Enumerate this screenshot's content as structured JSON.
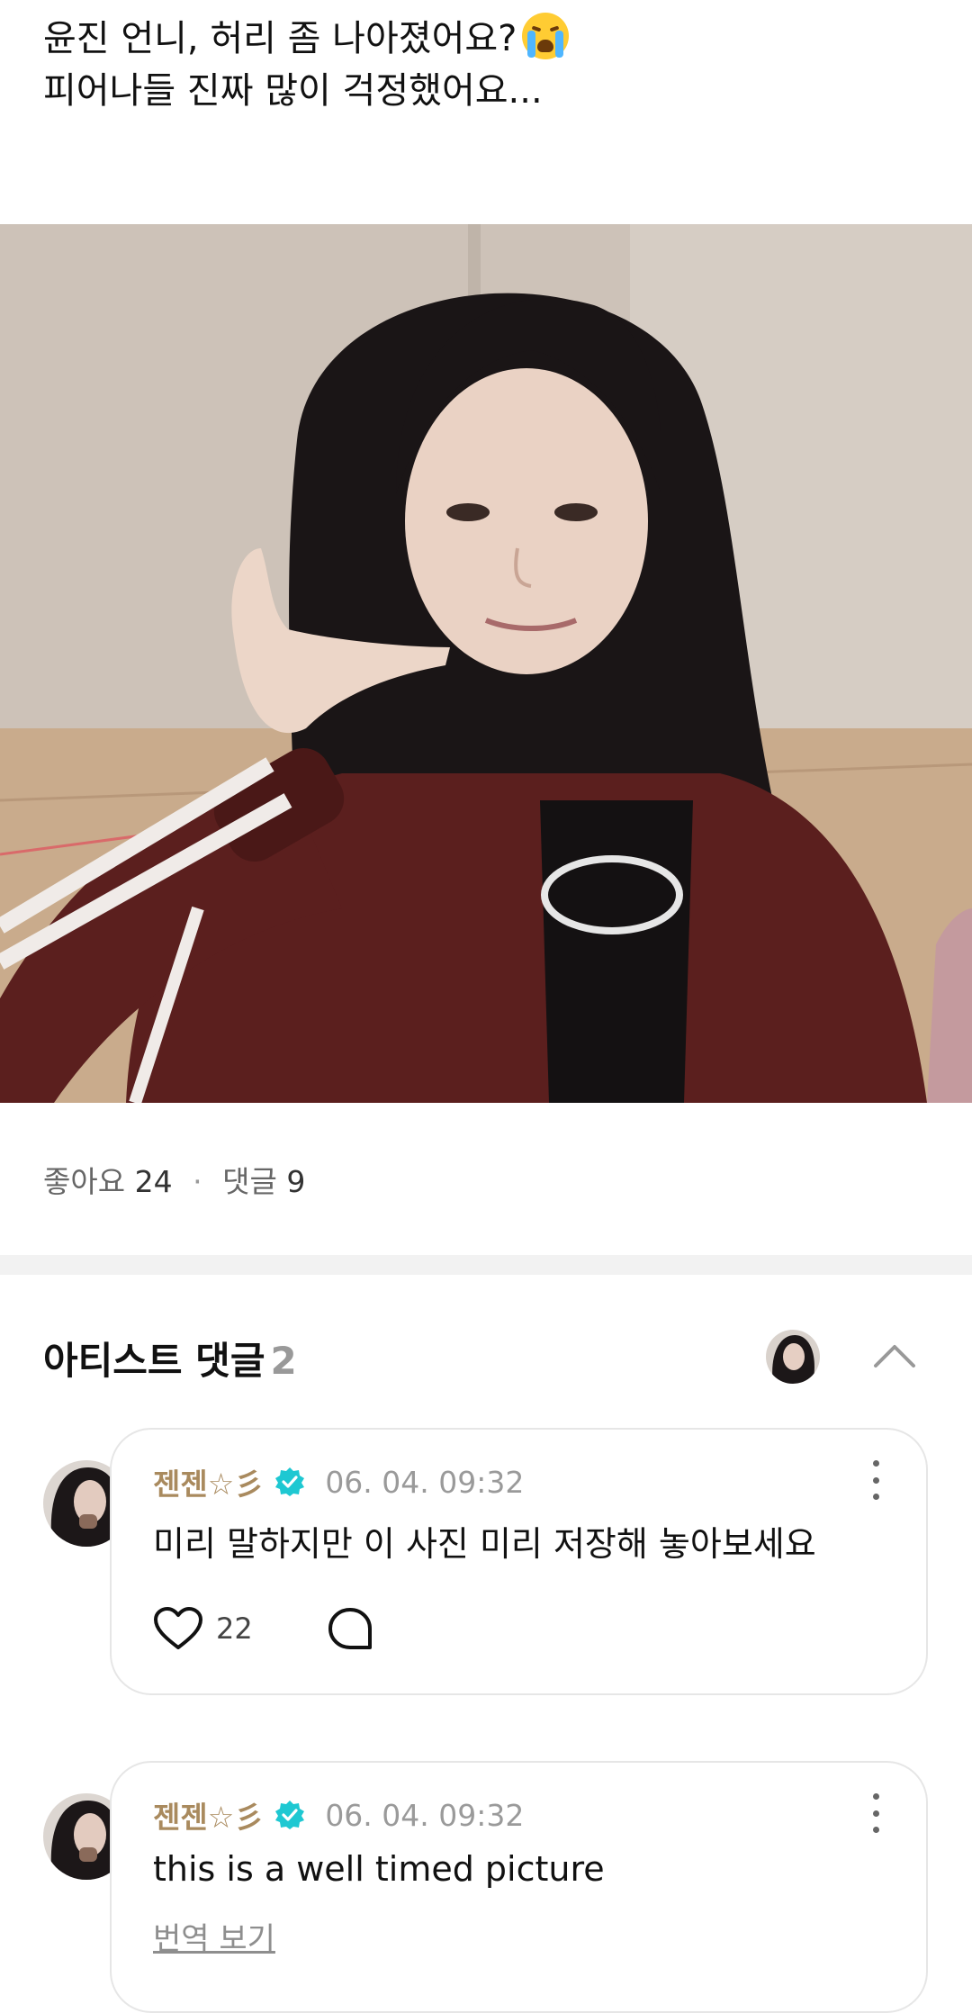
{
  "post": {
    "text_line1": "윤진 언니, 허리 좀 나아졌어요?",
    "text_line2": "피어나들 진짜 많이 걱정했어요...",
    "emoji": "loudly-crying-face"
  },
  "stats": {
    "likes_label": "좋아요",
    "likes_count": "24",
    "separator": "·",
    "comments_label": "댓글",
    "comments_count": "9"
  },
  "artist_comments": {
    "title": "아티스트 댓글",
    "count": "2",
    "collapse_icon": "chevron-up-icon"
  },
  "comments": [
    {
      "author": "젠젠☆彡",
      "timestamp": "06. 04. 09:32",
      "body": "미리 말하지만 이 사진 미리 저장해 놓아보세요",
      "like_count": "22"
    },
    {
      "author": "젠젠☆彡",
      "timestamp": "06. 04. 09:32",
      "body": "this is a well timed picture",
      "translate_label": "번역 보기"
    }
  ],
  "colors": {
    "author": "#a98a5e",
    "verified_badge": "#1ec8d2",
    "divider": "#f2f2f2",
    "jacket": "#5b1f1e"
  }
}
